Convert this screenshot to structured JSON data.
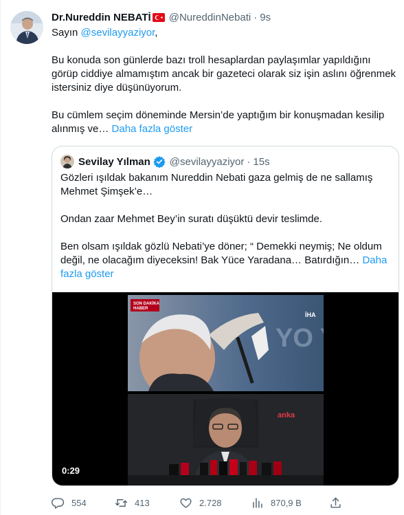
{
  "tweet": {
    "author_name": "Dr.Nureddin NEBATİ",
    "handle": "@NureddinNebati",
    "separator": "·",
    "time": "9s",
    "greeting_prefix": "Sayın ",
    "greeting_mention": "@sevilayyaziyor",
    "greeting_suffix": ",",
    "para1": "Bu konuda son günlerde bazı troll hesaplardan paylaşımlar yapıldığını görüp ciddiye almamıştım ancak bir gazeteci olarak siz işin aslını öğrenmek istersiniz diye düşünüyorum.",
    "para2": "Bu cümlem seçim döneminde Mersin’de yaptığım bir konuşmadan kesilip alınmış ve… ",
    "show_more": "Daha fazla göster"
  },
  "quote": {
    "author_name": "Sevilay Yılman",
    "handle": "@sevilayyaziyor",
    "separator": "·",
    "time": "15s",
    "para1": "Gözleri ışıldak bakanım Nureddin Nebati gaza gelmiş de ne sallamış Mehmet Şimşek’e…",
    "para2": "Ondan zaar Mehmet Bey’in suratı düşüktü devir teslimde.",
    "para3": "Ben olsam ışıldak gözlü Nebati’ye döner; “ Demekki neymiş; Ne oldum değil, ne olacağım diyeceksin! Bak Yüce Yaradana… Batırdığın… ",
    "show_more": "Daha fazla göster",
    "video": {
      "duration": "0:29",
      "top_banner_line1": "SON DAKİKA",
      "top_banner_line2": "HABER",
      "top_watermark": "İHA",
      "top_backdrop_text": "YO YÜ",
      "bottom_watermark": "anka"
    }
  },
  "actions": {
    "replies": "554",
    "retweets": "413",
    "likes": "2.728",
    "views": "870,9 B"
  },
  "colors": {
    "link": "#1d9bf0",
    "secondary_text": "#536471",
    "border": "#cfd9de",
    "verified": "#1d9bf0"
  },
  "icons": [
    "reply-icon",
    "retweet-icon",
    "like-icon",
    "views-icon",
    "share-icon",
    "verified-icon",
    "flag-icon"
  ]
}
